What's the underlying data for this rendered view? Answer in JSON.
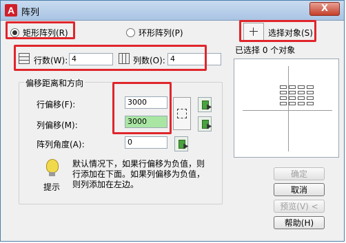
{
  "title": "阵列",
  "close_symbol": "X",
  "mode": {
    "rect_label": "矩形阵列(R)",
    "polar_label": "环形阵列(P)",
    "selected": "rect"
  },
  "select_objects": {
    "button_label": "选择对象(S)",
    "status": "已选择 0 个对象"
  },
  "rows": {
    "label": "行数(W):",
    "value": "4"
  },
  "cols": {
    "label": "列数(O):",
    "value": "4"
  },
  "offset_group": {
    "title": "偏移距离和方向",
    "row_offset_label": "行偏移(F):",
    "row_offset_value": "3000",
    "col_offset_label": "列偏移(M):",
    "col_offset_value": "3000",
    "angle_label": "阵列角度(A):",
    "angle_value": "0"
  },
  "tip": {
    "label": "提示",
    "text": "默认情况下，如果行偏移为负值，则行添加在下面。如果列偏移为负值，则列添加在左边。"
  },
  "buttons": {
    "ok": "确定",
    "cancel": "取消",
    "preview": "预览(V) <",
    "help": "帮助(H)"
  },
  "preview": {
    "rows": 4,
    "cols": 4
  }
}
